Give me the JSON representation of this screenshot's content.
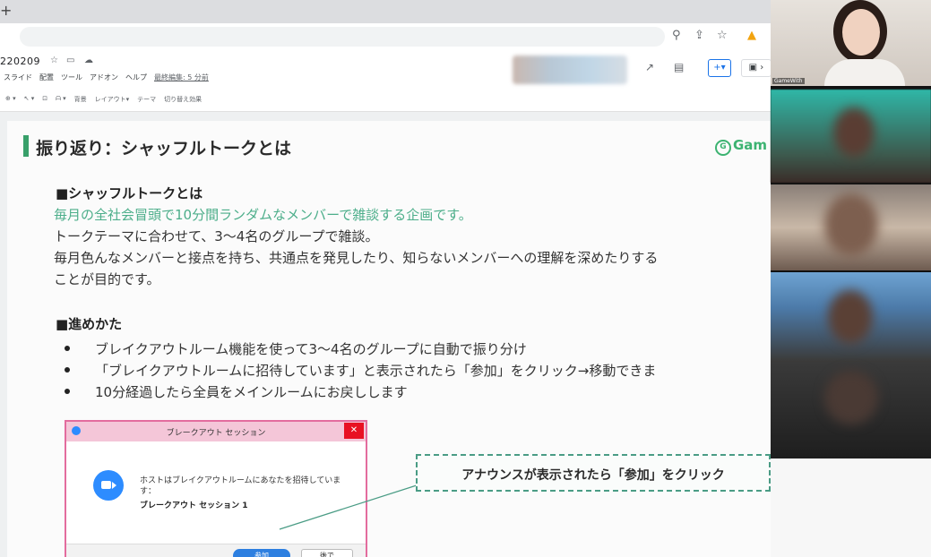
{
  "browser": {
    "new_tab_icon": "+"
  },
  "doc": {
    "title": "220209",
    "menu": [
      "スライド",
      "配置",
      "ツール",
      "アドオン",
      "ヘルプ"
    ],
    "last_edit": "最終編集: 5 分前"
  },
  "toolbar": {
    "items": [
      "背景",
      "レイアウト▾",
      "テーマ",
      "切り替え効果"
    ]
  },
  "slide": {
    "title": "振り返り：シャッフルトークとは",
    "logo_text": "Gam",
    "section1_heading": "■シャッフルトークとは",
    "section1_lines": [
      "毎月の全社会冒頭で10分間ランダムなメンバーで雑談する企画です。",
      "トークテーマに合わせて、3～4名のグループで雑談。",
      "毎月色んなメンバーと接点を持ち、共通点を発見したり、知らないメンバーへの理解を深めたりする",
      "ことが目的です。"
    ],
    "section2_heading": "■進めかた",
    "bullets": [
      "ブレイクアウトルーム機能を使って3～4名のグループに自動で振り分け",
      "「ブレイクアウトルームに招待しています」と表示されたら「参加」をクリック→移動できま",
      "10分経過したら全員をメインルームにお戻しします"
    ],
    "dialog": {
      "title": "ブレークアウト セッション",
      "close": "✕",
      "message": "ホストはブレイクアウトルームにあなたを招待しています：",
      "session": "ブレークアウト セッション 1",
      "join": "参加",
      "later": "後で"
    },
    "callout": "アナウンスが表示されたら「参加」をクリック"
  },
  "video": {
    "speaker_name": "GameWith"
  }
}
